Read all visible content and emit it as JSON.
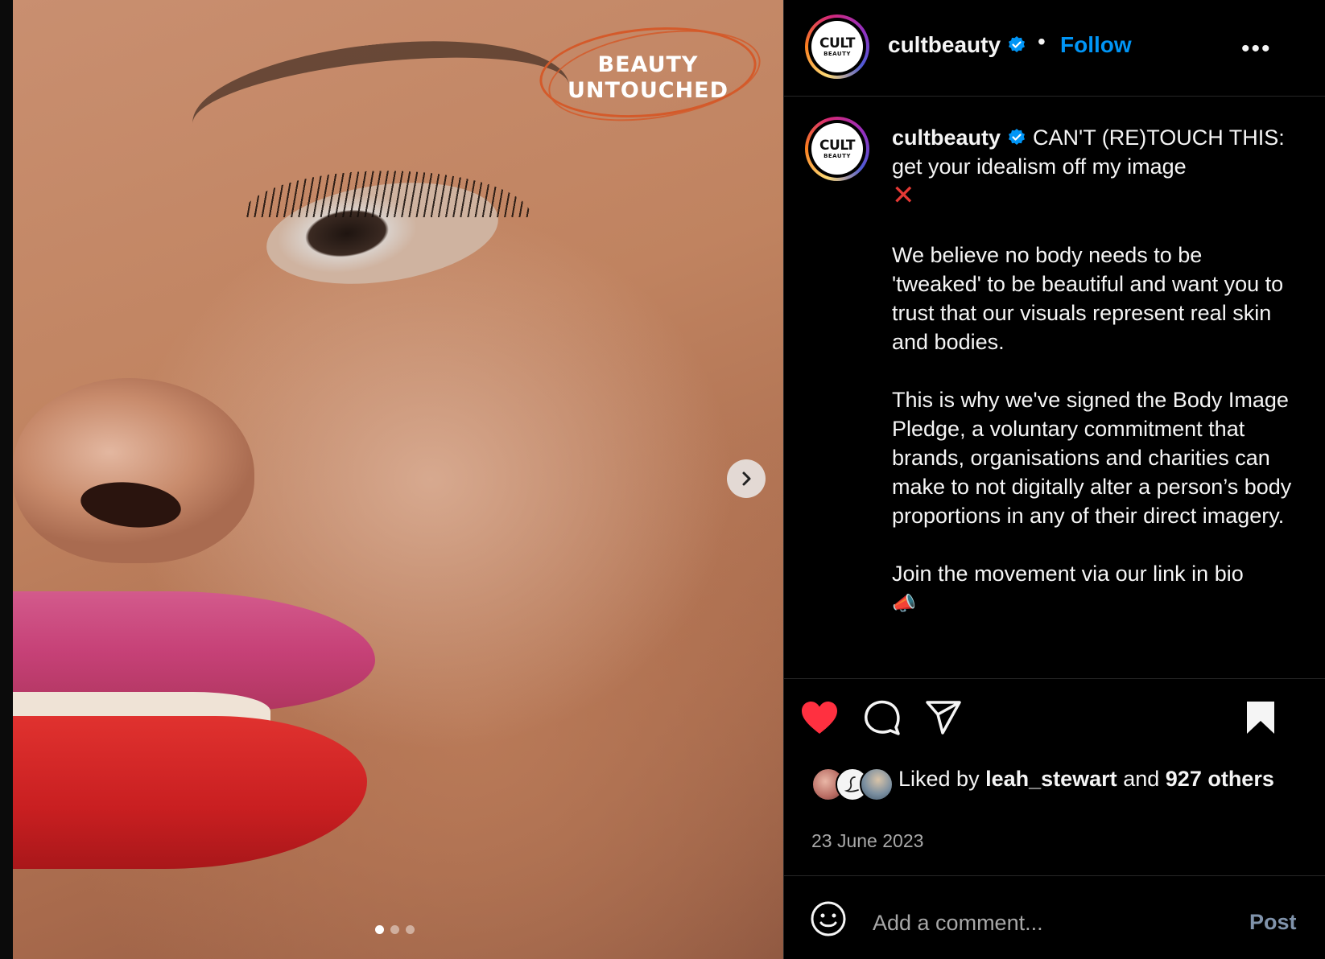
{
  "post_image": {
    "overlay_line1": "BEAUTY",
    "overlay_line2": "UNTOUCHED",
    "carousel_total": 3,
    "carousel_index": 1
  },
  "header": {
    "username": "cultbeauty",
    "separator": "•",
    "follow_label": "Follow",
    "more_label": "•••",
    "avatar_text_big": "CULT",
    "avatar_text_small": "BEAUTY"
  },
  "caption": {
    "username": "cultbeauty",
    "first_line": "CAN'T (RE)TOUCH THIS: get your idealism off my image",
    "first_emoji": "✕",
    "paragraphs": [
      "We believe no body needs to be 'tweaked' to be beautiful and want you to trust that our visuals represent real skin and bodies.",
      "This is why we've signed the Body Image Pledge, a voluntary commitment that brands, organisations and charities can make to not digitally alter a person’s body proportions in any of their direct imagery.",
      "Join the movement via our link in bio"
    ],
    "last_emoji": "📣"
  },
  "likes": {
    "prefix": "Liked by",
    "user": "leah_stewart",
    "conjunction": "and",
    "count_text": "927 others"
  },
  "date": "23 June 2023",
  "comment": {
    "placeholder": "Add a comment...",
    "post_label": "Post"
  },
  "colors": {
    "accent_blue": "#0095f6",
    "like_red": "#ff3040",
    "background": "#000000",
    "muted_text": "#a8a8a8"
  }
}
